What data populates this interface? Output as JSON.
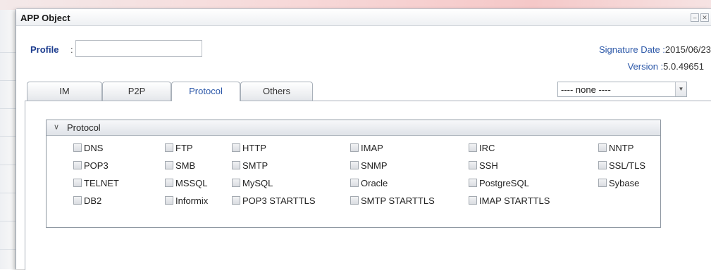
{
  "window": {
    "title": "APP Object",
    "minimize_glyph": "–",
    "close_glyph": "✕"
  },
  "profile": {
    "label": "Profile",
    "colon": ":",
    "value": "",
    "placeholder": ""
  },
  "signature": {
    "date_label": "Signature Date :",
    "date_value": "2015/06/23",
    "version_label": "Version :",
    "version_value": "5.0.49651"
  },
  "tabs": [
    {
      "label": "IM",
      "active": false
    },
    {
      "label": "P2P",
      "active": false
    },
    {
      "label": "Protocol",
      "active": true
    },
    {
      "label": "Others",
      "active": false
    }
  ],
  "filter_select": {
    "selected": "---- none ----"
  },
  "group": {
    "title": "Protocol",
    "chevron": "chevron-down-icon",
    "items": [
      [
        "DNS",
        "FTP",
        "HTTP",
        "IMAP",
        "IRC",
        "NNTP"
      ],
      [
        "POP3",
        "SMB",
        "SMTP",
        "SNMP",
        "SSH",
        "SSL/TLS"
      ],
      [
        "TELNET",
        "MSSQL",
        "MySQL",
        "Oracle",
        "PostgreSQL",
        "Sybase"
      ],
      [
        "DB2",
        "Informix",
        "POP3 STARTTLS",
        "SMTP STARTTLS",
        "IMAP STARTTLS"
      ]
    ]
  }
}
